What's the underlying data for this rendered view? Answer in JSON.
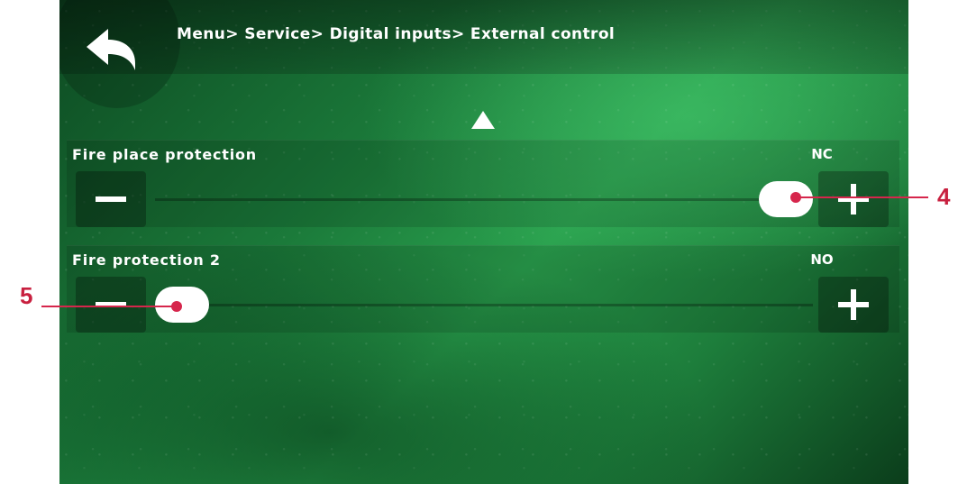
{
  "header": {
    "breadcrumb": "Menu> Service> Digital inputs> External control"
  },
  "icons": {
    "back": "back-arrow-icon",
    "scroll_up": "triangle-up-icon",
    "minus": "minus-icon",
    "plus": "plus-icon"
  },
  "settings": [
    {
      "label": "Fire place protection",
      "value": "NC",
      "slider_position": 1.0
    },
    {
      "label": "Fire protection 2",
      "value": "NO",
      "slider_position": 0.0
    }
  ],
  "callouts": [
    {
      "number": "4",
      "target": "settings.0.slider"
    },
    {
      "number": "5",
      "target": "settings.1.slider"
    }
  ],
  "colors": {
    "accent_green": "#1b7a3a",
    "callout_red": "#d6264c"
  }
}
